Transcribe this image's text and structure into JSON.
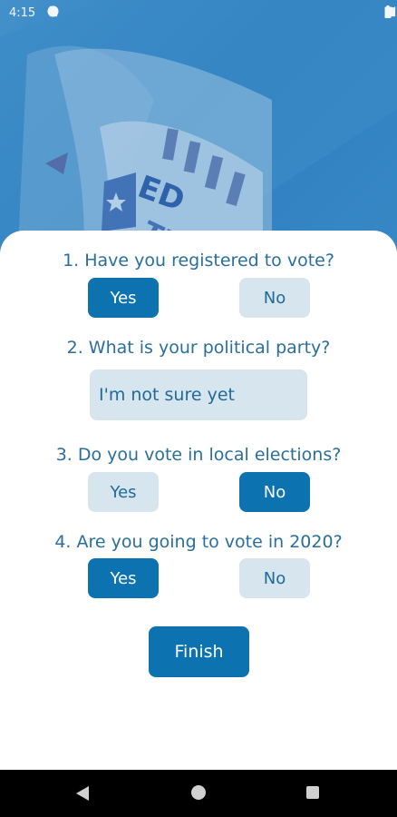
{
  "status_bar": {
    "time": "4:15",
    "icons": [
      "settings-icon",
      "a-circle-icon",
      "shield-icon",
      "sd-card-icon",
      "wifi-icon",
      "signal-icon",
      "battery-icon"
    ]
  },
  "colors": {
    "accent": "#0d72b0",
    "inactive_button": "#d7e5ee",
    "question_text": "#2a6f9b",
    "hero_blue": "#3a8bc8"
  },
  "questions": [
    {
      "text": "1. Have you registered to vote?",
      "options": [
        "Yes",
        "No"
      ],
      "selected": "Yes"
    },
    {
      "text": "2. What is your political party?",
      "value": "I'm not sure yet"
    },
    {
      "text": "3. Do you vote in local elections?",
      "options": [
        "Yes",
        "No"
      ],
      "selected": "No"
    },
    {
      "text": "4. Are you going to vote in 2020?",
      "options": [
        "Yes",
        "No"
      ],
      "selected": "Yes"
    }
  ],
  "finish_label": "Finish",
  "nav_bar": {
    "icons": [
      "back-icon",
      "home-icon",
      "recents-icon"
    ]
  }
}
